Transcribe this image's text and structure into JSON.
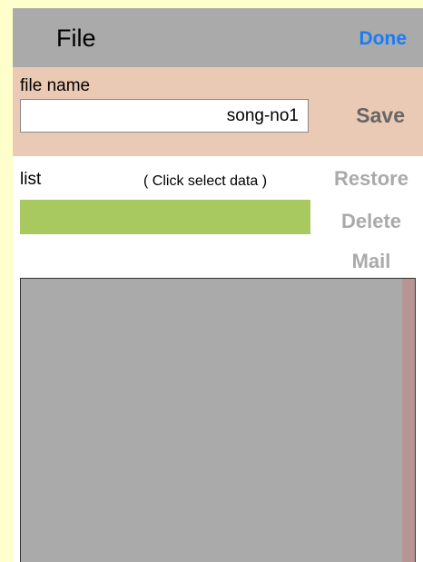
{
  "header": {
    "title": "File",
    "done_label": "Done"
  },
  "save_section": {
    "file_name_label": "file name",
    "file_name_value": "song-no1",
    "save_label": "Save"
  },
  "list_section": {
    "label": "list",
    "hint": "( Click select data )"
  },
  "actions": {
    "restore": "Restore",
    "delete": "Delete",
    "mail": "Mail"
  },
  "colors": {
    "header_bg": "#aaaaaa",
    "accent": "#1a7cf5",
    "save_bg": "#eacab4",
    "list_selection": "#a8c860",
    "page_bg": "#ffffcc"
  }
}
